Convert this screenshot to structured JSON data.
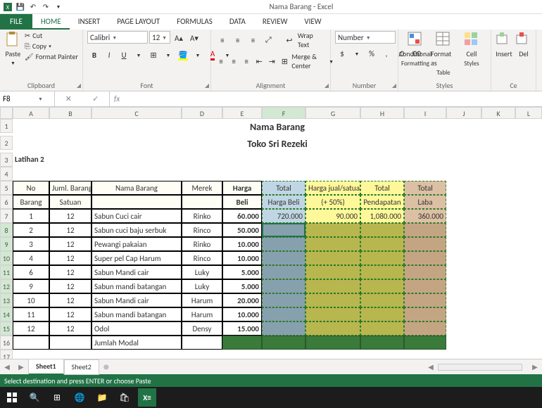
{
  "window": {
    "title": "Nama Barang - Excel"
  },
  "tabs": {
    "file": "FILE",
    "home": "HOME",
    "insert": "INSERT",
    "page": "PAGE LAYOUT",
    "formulas": "FORMULAS",
    "data": "DATA",
    "review": "REVIEW",
    "view": "VIEW"
  },
  "ribbon": {
    "clipboard": {
      "label": "Clipboard",
      "paste": "Paste",
      "cut": "Cut",
      "copy": "Copy",
      "fmtpainter": "Format Painter"
    },
    "font": {
      "label": "Font",
      "name": "Calibri",
      "size": "12"
    },
    "alignment": {
      "label": "Alignment",
      "wrap": "Wrap Text",
      "merge": "Merge & Center"
    },
    "number": {
      "label": "Number",
      "format": "Number"
    },
    "styles": {
      "label": "Styles",
      "cond": "Conditional",
      "cond2": "Formatting",
      "fmt": "Format as",
      "fmt2": "Table",
      "cell": "Cell",
      "cell2": "Styles"
    },
    "cells": {
      "label": "Ce",
      "insert": "Insert",
      "delete": "Del"
    }
  },
  "formulabar": {
    "namebox": "F8",
    "fx": "fx"
  },
  "sheet": {
    "cols": [
      "A",
      "B",
      "C",
      "D",
      "E",
      "F",
      "G",
      "H",
      "I",
      "J",
      "K",
      "L"
    ],
    "title1": "Nama Barang",
    "title2": "Toko Sri Rezeki",
    "latihan": "Latihan 2",
    "hdr": {
      "no": "No",
      "jml": "Juml. Barang",
      "nama": "Nama Barang",
      "merek": "Merek",
      "harga": "Harga",
      "total": "Total",
      "hargajual": "Harga jual/satuan",
      "total2": "Total",
      "total3": "Total",
      "barang": "Barang",
      "satuan": "Satuan",
      "beli": "Beli",
      "hargabeli": "Harga Beli",
      "p50": "(+ 50%)",
      "pendapatan": "Pendapatan",
      "laba": "Laba"
    },
    "rows": [
      {
        "no": "1",
        "jml": "12",
        "nama": "Sabun Cuci cair",
        "merek": "Rinko",
        "harga": "60.000",
        "f": "720.000",
        "g": "90.000",
        "h": "1,080.000",
        "i": "360.000"
      },
      {
        "no": "2",
        "jml": "12",
        "nama": "Sabun cuci baju serbuk",
        "merek": "Rinco",
        "harga": "50.000"
      },
      {
        "no": "3",
        "jml": "12",
        "nama": "Pewangi pakaian",
        "merek": "Rinko",
        "harga": "10.000"
      },
      {
        "no": "4",
        "jml": "12",
        "nama": "Super pel Cap Harum",
        "merek": "Rinco",
        "harga": "10.000"
      },
      {
        "no": "6",
        "jml": "12",
        "nama": "Sabun Mandi cair",
        "merek": "Luky",
        "harga": "5.000"
      },
      {
        "no": "9",
        "jml": "12",
        "nama": "Sabun mandi batangan",
        "merek": "Luky",
        "harga": "5.000"
      },
      {
        "no": "10",
        "jml": "12",
        "nama": "Sabun Mandi cair",
        "merek": "Harum",
        "harga": "20.000"
      },
      {
        "no": "11",
        "jml": "12",
        "nama": "Sabun mandi batangan",
        "merek": "Harum",
        "harga": "10.000"
      },
      {
        "no": "12",
        "jml": "12",
        "nama": "Odol",
        "merek": "Densy",
        "harga": "15.000"
      }
    ],
    "jumlahmodal": "Jumlah Modal"
  },
  "tabsbar": {
    "sheet1": "Sheet1",
    "sheet2": "Sheet2"
  },
  "status": {
    "msg": "Select destination and press ENTER or choose Paste"
  }
}
